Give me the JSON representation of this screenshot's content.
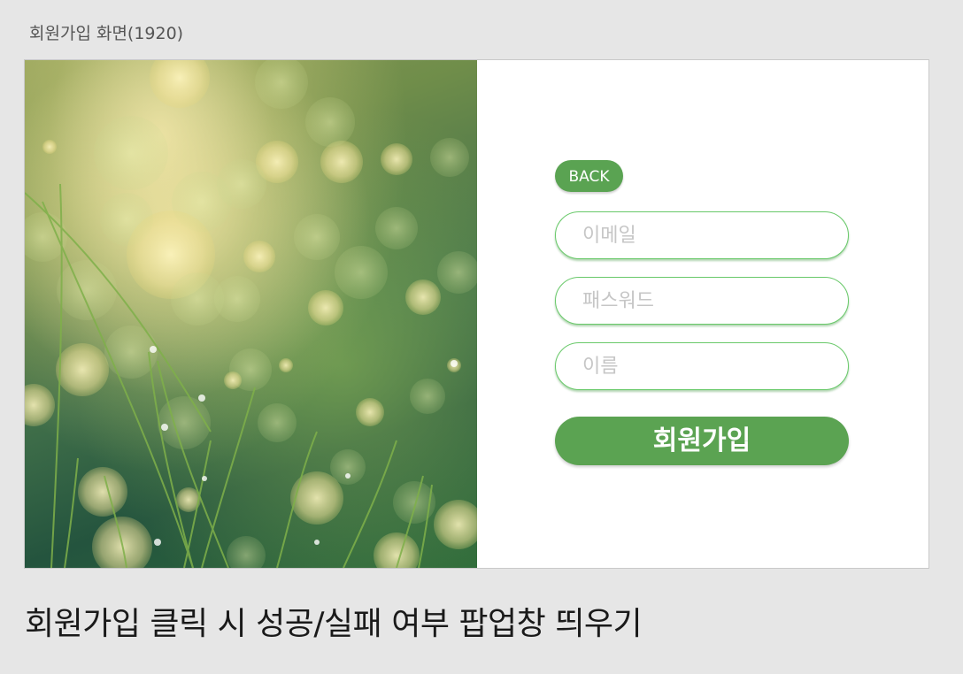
{
  "frame": {
    "title": "회원가입 화면(1920)"
  },
  "hero_image": {
    "description_icon": "grass-bokeh-photo-icon"
  },
  "form": {
    "back_label": "BACK",
    "email_placeholder": "이메일",
    "password_placeholder": "패스워드",
    "name_placeholder": "이름",
    "signup_label": "회원가입"
  },
  "annotation": {
    "text": "회원가입 클릭 시 성공/실패 여부 팝업창 띄우기"
  },
  "colors": {
    "accent": "#5ba352",
    "field_border": "#69c96a",
    "background": "#e6e6e6"
  }
}
